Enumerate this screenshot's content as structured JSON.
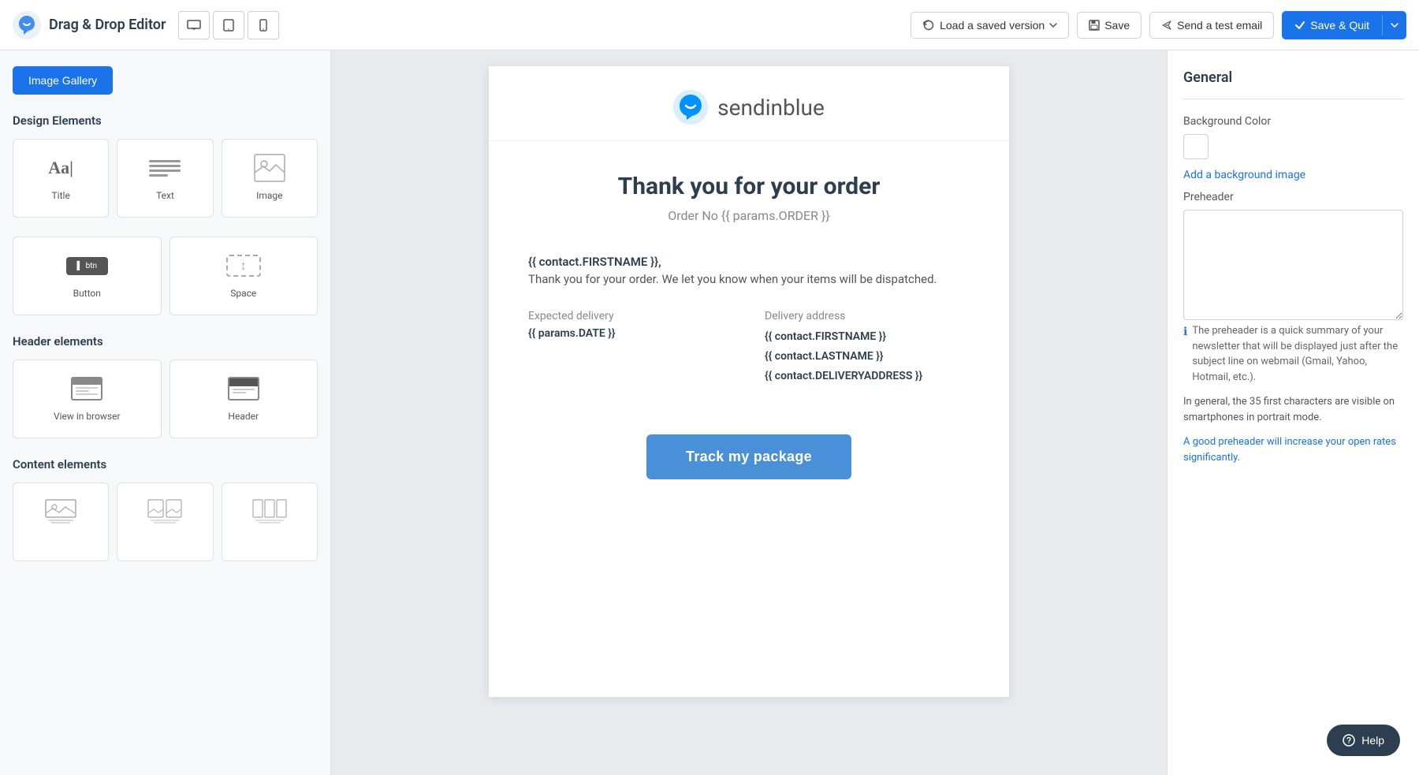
{
  "topbar": {
    "app_title": "Drag & Drop Editor",
    "device_icons": [
      "desktop",
      "tablet",
      "mobile"
    ],
    "load_version_label": "Load a saved version",
    "save_label": "Save",
    "test_email_label": "Send a test email",
    "save_quit_label": "Save & Quit"
  },
  "left_sidebar": {
    "image_gallery_btn": "Image Gallery",
    "design_elements_title": "Design Elements",
    "elements": [
      {
        "name": "title-element",
        "label": "Title"
      },
      {
        "name": "text-element",
        "label": "Text"
      },
      {
        "name": "image-element",
        "label": "Image"
      },
      {
        "name": "button-element",
        "label": "Button"
      },
      {
        "name": "space-element",
        "label": "Space"
      }
    ],
    "header_elements_title": "Header elements",
    "header_elements": [
      {
        "name": "view-in-browser",
        "label": "View in browser"
      },
      {
        "name": "header-element",
        "label": "Header"
      }
    ],
    "content_elements_title": "Content elements"
  },
  "email_canvas": {
    "logo_text": "sendinblue",
    "main_title": "Thank you for your order",
    "order_number": "Order No {{ params.ORDER }}",
    "greeting_name": "{{ contact.FIRSTNAME }},",
    "greeting_body": "Thank you for your order. We let you know when your items will be dispatched.",
    "expected_delivery_label": "Expected delivery",
    "expected_delivery_value": "{{ params.DATE }}",
    "delivery_address_label": "Delivery address",
    "delivery_address_line1": "{{ contact.FIRSTNAME }}",
    "delivery_address_line2": "{{ contact.LASTNAME }}",
    "delivery_address_line3": "{{ contact.DELIVERYADDRESS }}",
    "track_btn_label": "Track my package"
  },
  "right_sidebar": {
    "section_title": "General",
    "bg_color_label": "Background Color",
    "add_bg_image_link": "Add a background image",
    "preheader_label": "Preheader",
    "preheader_placeholder": "",
    "info_text": "The preheader is a quick summary of your newsletter that will be displayed just after the subject line on webmail (Gmail, Yahoo, Hotmail, etc.).",
    "note_text": "In general, the 35 first characters are visible on smartphones in portrait mode.",
    "good_text": "A good preheader will increase your open rates significantly."
  },
  "help_btn_label": "Help"
}
